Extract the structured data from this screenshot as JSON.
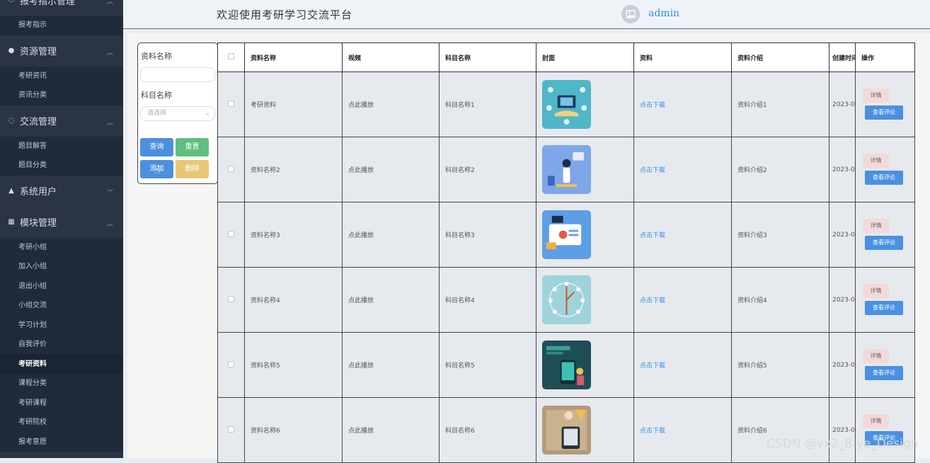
{
  "sidebar": {
    "groups": [
      {
        "label": "报考指示管理",
        "icon": "info-circle-icon",
        "items": [
          "报考指示"
        ]
      },
      {
        "label": "资源管理",
        "icon": "location-pin-icon",
        "items": [
          "考研资讯",
          "资讯分类"
        ]
      },
      {
        "label": "交流管理",
        "icon": "chat-bubble-icon",
        "items": [
          "题目解答",
          "题目分类"
        ]
      },
      {
        "label": "系统用户",
        "icon": "user-icon",
        "items": []
      },
      {
        "label": "模块管理",
        "icon": "grid-icon",
        "items": [
          "考研小组",
          "加入小组",
          "退出小组",
          "小组交流",
          "学习计划",
          "自我评价",
          "考研资料",
          "课程分类",
          "考研课程",
          "考研院校",
          "报考意愿"
        ]
      }
    ],
    "active_item": "考研资料"
  },
  "header": {
    "title": "欢迎使用考研学习交流平台",
    "user": "admin"
  },
  "search": {
    "field1_label": "资料名称",
    "field1_value": "",
    "field2_label": "科目名称",
    "field2_placeholder": "请选择",
    "query_label": "查询",
    "reset_label": "重置",
    "add_label": "添加",
    "delete_label": "删除"
  },
  "table": {
    "headers": [
      "资料名称",
      "视频",
      "科目名称",
      "封面",
      "资料",
      "资料介绍",
      "创建时间",
      "操作"
    ],
    "rows": [
      {
        "name": "考研资料",
        "video": "点此播放",
        "subject": "科目名称1",
        "file": "点击下载",
        "intro": "资料介绍1",
        "created": "2023-0",
        "cover_color": "#4fb7c8"
      },
      {
        "name": "资料名称2",
        "video": "点此播放",
        "subject": "科目名称2",
        "file": "点击下载",
        "intro": "资料介绍2",
        "created": "2023-0",
        "cover_color": "#7fa6e8"
      },
      {
        "name": "资料名称3",
        "video": "点此播放",
        "subject": "科目名称3",
        "file": "点击下载",
        "intro": "资料介绍3",
        "created": "2023-0",
        "cover_color": "#5d9ee6"
      },
      {
        "name": "资料名称4",
        "video": "点此播放",
        "subject": "科目名称4",
        "file": "点击下载",
        "intro": "资料介绍4",
        "created": "2023-0",
        "cover_color": "#9fd3dc"
      },
      {
        "name": "资料名称5",
        "video": "点此播放",
        "subject": "科目名称5",
        "file": "点击下载",
        "intro": "资料介绍5",
        "created": "2023-0",
        "cover_color": "#1f4e57"
      },
      {
        "name": "资料名称6",
        "video": "点此播放",
        "subject": "科目名称6",
        "file": "点击下载",
        "intro": "资料介绍6",
        "created": "2023-0",
        "cover_color": "#b39a7a"
      }
    ],
    "detail_label": "详情",
    "comment_label": "查看评论"
  },
  "watermark": "CSDN @vx2_Biye_Design"
}
